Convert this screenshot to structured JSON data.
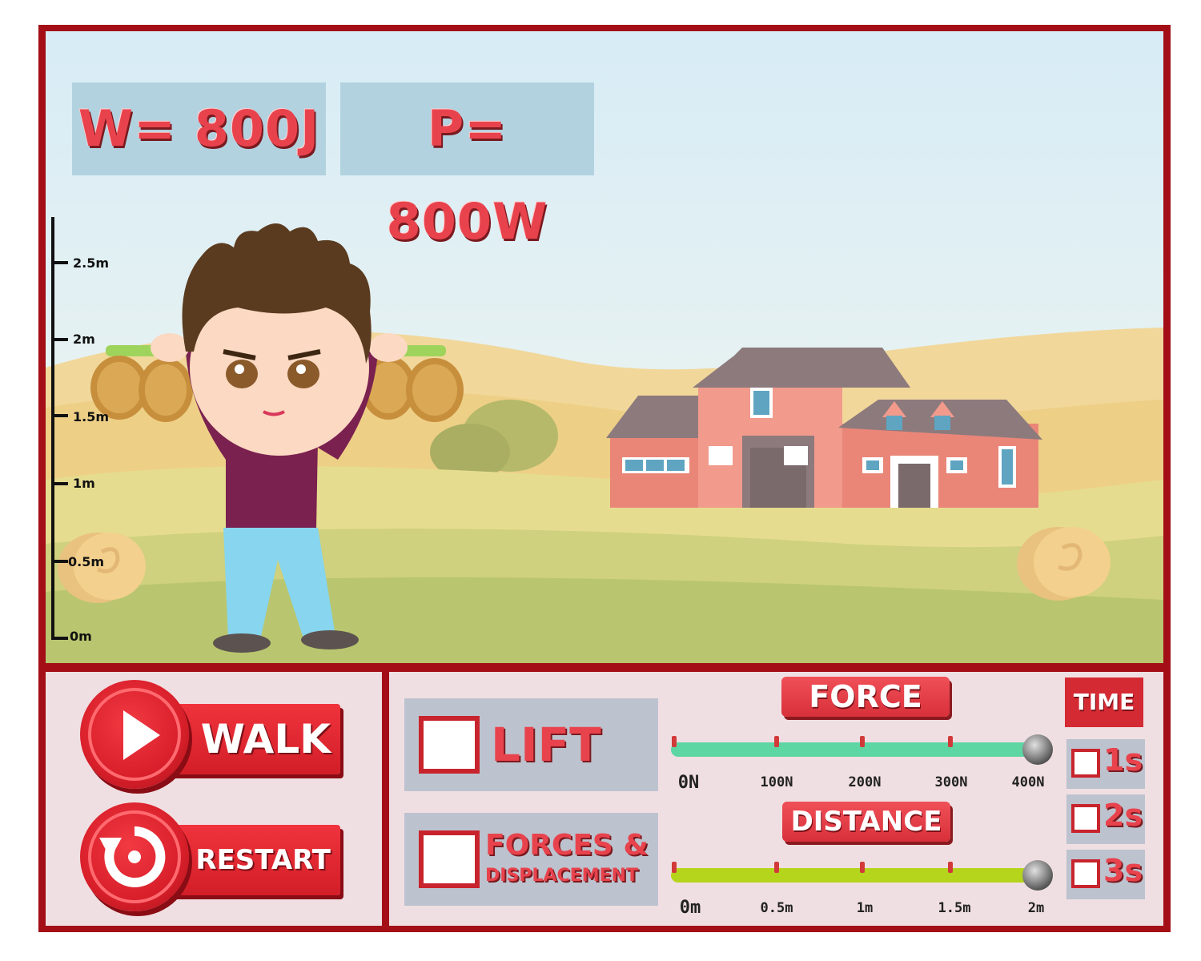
{
  "readouts": {
    "work": "W= 800J",
    "power": "P= 800W"
  },
  "ruler": {
    "labels": [
      "2.5m",
      "2m",
      "1.5m",
      "1m",
      "0.5m",
      "0m"
    ]
  },
  "controls": {
    "walk_label": "WALK",
    "restart_label": "RESTART",
    "lift_label": "LIFT",
    "forces_label": "FORCES &",
    "displacement_label": "DISPLACEMENT"
  },
  "force": {
    "title": "FORCE",
    "ticks": [
      "0N",
      "100N",
      "200N",
      "300N",
      "400N"
    ],
    "value_fraction": 1.0
  },
  "distance": {
    "title": "DISTANCE",
    "ticks": [
      "0m",
      "0.5m",
      "1m",
      "1.5m",
      "2m"
    ],
    "value_fraction": 1.0
  },
  "time": {
    "title": "TIME",
    "options": [
      "1s",
      "2s",
      "3s"
    ]
  },
  "colors": {
    "frame": "#a30e17",
    "accent": "#e8434d",
    "force_track": "#5dd6a4",
    "distance_track": "#b5d41c"
  }
}
